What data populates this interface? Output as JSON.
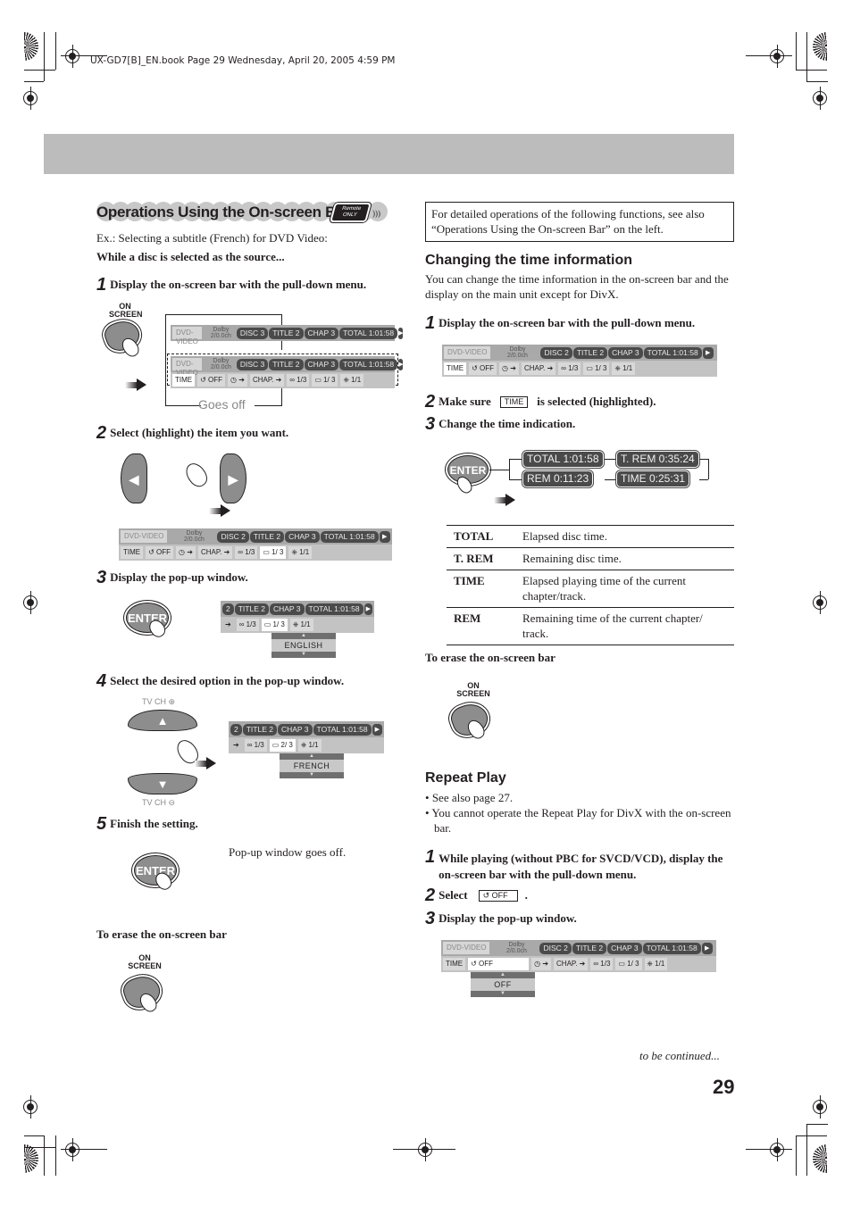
{
  "file_header": "UX-GD7[B]_EN.book  Page 29  Wednesday, April 20, 2005  4:59 PM",
  "left": {
    "title": "Operations Using the On-screen Bar",
    "badge": {
      "line1": "Remote",
      "line2": "ONLY",
      "icon": "remote-signal-icon"
    },
    "example": "Ex.: Selecting a subtitle (French) for DVD Video:",
    "condition": "While a disc is selected as the source...",
    "steps": [
      {
        "num": "1",
        "text": "Display the on-screen bar with the pull-down menu."
      },
      {
        "num": "2",
        "text": "Select (highlight) the item you want."
      },
      {
        "num": "3",
        "text": "Display the pop-up window."
      },
      {
        "num": "4",
        "text": "Select the desired option in the pop-up window."
      },
      {
        "num": "5",
        "text": "Finish the setting."
      }
    ],
    "goes_off": "Goes off",
    "popup_goes_off": "Pop-up window goes off.",
    "erase_heading": "To erase the on-screen bar",
    "popup_english": "ENGLISH",
    "popup_french": "FRENCH",
    "tv_ch_plus": "TV CH ⊕",
    "tv_ch_minus": "TV CH ⊖"
  },
  "buttons": {
    "on_screen_line1": "ON",
    "on_screen_line2": "SCREEN",
    "enter": "ENTER",
    "left_arrow": "◀",
    "right_arrow": "▶",
    "up_arrow": "▲",
    "down_arrow": "▼"
  },
  "osb_disc3": {
    "source": "DVD-VIDEO",
    "dolby1": "Dolby",
    "dolby2": "2/0.0ch",
    "disc": "DISC 3",
    "title": "TITLE  2",
    "chap": "CHAP  3",
    "total": "TOTAL   1:01:58"
  },
  "osb_disc2": {
    "source": "DVD-VIDEO",
    "dolby1": "Dolby",
    "dolby2": "2/0.0ch",
    "disc": "DISC 2",
    "title": "TITLE  2",
    "chap": "CHAP  3",
    "total": "TOTAL   1:01:58"
  },
  "osb_menu": {
    "time": "TIME",
    "repeat": "↺ OFF",
    "timer": "◷ ➔",
    "chap": "CHAP. ➔",
    "audio": "∞ 1/3",
    "subtitle": "▭ 1/ 3",
    "subtitle_fr": "▭ 2/ 3",
    "angle": "⎈ 1/1",
    "title_partial": "2"
  },
  "right": {
    "note": "For detailed operations of the following functions, see also “Operations Using the On-screen Bar” on the left.",
    "time_section": {
      "title": "Changing the time information",
      "intro": "You can change the time information in the on-screen bar and the display on the main unit except for DivX.",
      "step1": "Display the on-screen bar with the pull-down menu.",
      "step2_pre": "Make sure",
      "step2_box": "TIME",
      "step2_post": "is selected (highlighted).",
      "step3": "Change the time indication.",
      "cycle": {
        "total": "TOTAL   1:01:58",
        "trem": "T. REM  0:35:24",
        "time": "TIME   0:25:31",
        "rem": "REM     0:11:23"
      },
      "table": [
        {
          "key": "TOTAL",
          "desc": "Elapsed disc time."
        },
        {
          "key": "T. REM",
          "desc": "Remaining disc time."
        },
        {
          "key": "TIME",
          "desc": "Elapsed playing time of the current chapter/track."
        },
        {
          "key": "REM",
          "desc": "Remaining time of the current chapter/ track."
        }
      ],
      "erase_heading": "To erase the on-screen bar"
    },
    "repeat_section": {
      "title": "Repeat Play",
      "bullets": [
        "See also page 27.",
        "You cannot operate the Repeat Play for DivX with the on-screen bar."
      ],
      "step1": "While playing (without PBC for SVCD/VCD), display the on-screen bar with the pull-down menu.",
      "step2_pre": "Select",
      "step2_box": "↺ OFF",
      "step2_post": ".",
      "step3": "Display the pop-up window.",
      "popup_value": "OFF"
    }
  },
  "footer": {
    "continued": "to be continued...",
    "page_number": "29"
  }
}
